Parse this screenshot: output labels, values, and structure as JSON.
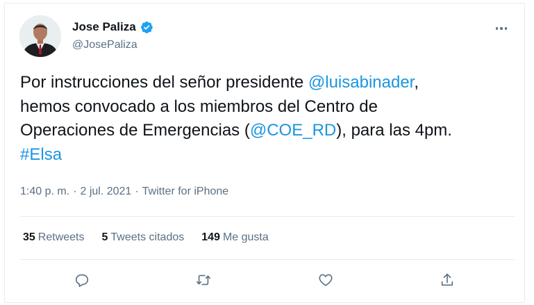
{
  "tweet": {
    "author_name": "Jose Paliza",
    "handle": "@JosePaliza",
    "verified": true,
    "text_parts": [
      {
        "text": "Por instrucciones del señor presidente ",
        "link": false
      },
      {
        "text": "@luisabinader",
        "link": true
      },
      {
        "text": ",\nhemos convocado a los miembros del Centro de\nOperaciones de Emergencias (",
        "link": false
      },
      {
        "text": "@COE_RD",
        "link": true
      },
      {
        "text": "), para las 4pm.\n",
        "link": false
      },
      {
        "text": "#Elsa",
        "link": true
      }
    ],
    "time": "1:40 p. m.",
    "separator": "·",
    "date": "2 jul. 2021",
    "source": "Twitter for iPhone"
  },
  "stats": {
    "retweets_count": "35",
    "retweets_label": "Retweets",
    "quotes_count": "5",
    "quotes_label": "Tweets citados",
    "likes_count": "149",
    "likes_label": "Me gusta"
  },
  "actions": [
    "reply-icon",
    "retweet-icon",
    "like-icon",
    "share-icon"
  ],
  "colors": {
    "link": "#1b95e0",
    "secondary": "#5b7083",
    "verified": "#1da1f2",
    "text": "#0f1419"
  }
}
